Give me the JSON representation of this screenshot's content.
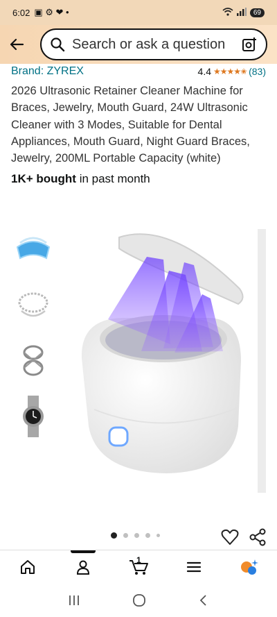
{
  "status_bar": {
    "time": "6:02",
    "battery": "69"
  },
  "header": {
    "search_placeholder": "Search or ask a question"
  },
  "product": {
    "brand": "Brand: ZYREX",
    "rating": "4.4",
    "stars": "★★★★✬",
    "rating_count": "(83)",
    "title": "2026 Ultrasonic Retainer Cleaner Machine for Braces, Jewelry, Mouth Guard, 24W Ultrasonic Cleaner with 3 Modes, Suitable for Dental Appliances, Mouth Guard, Night Guard Braces, Jewelry, 200ML Portable Capacity (white)",
    "bought_bold": "1K+ bought",
    "bought_rest": " in past month"
  },
  "gallery": {
    "thumbnails": [
      "mouth-guard-image",
      "bracelet-image",
      "ring-image",
      "watch-image"
    ],
    "active_dot": 0,
    "dot_count": 5
  },
  "bottom_nav": {
    "cart_count": "1",
    "items": [
      "home-icon",
      "account-icon",
      "cart-icon",
      "menu-icon",
      "rufus-icon"
    ]
  },
  "colors": {
    "accent_link": "#007185",
    "star": "#de7921",
    "header_bg": "#f6d6b2"
  }
}
